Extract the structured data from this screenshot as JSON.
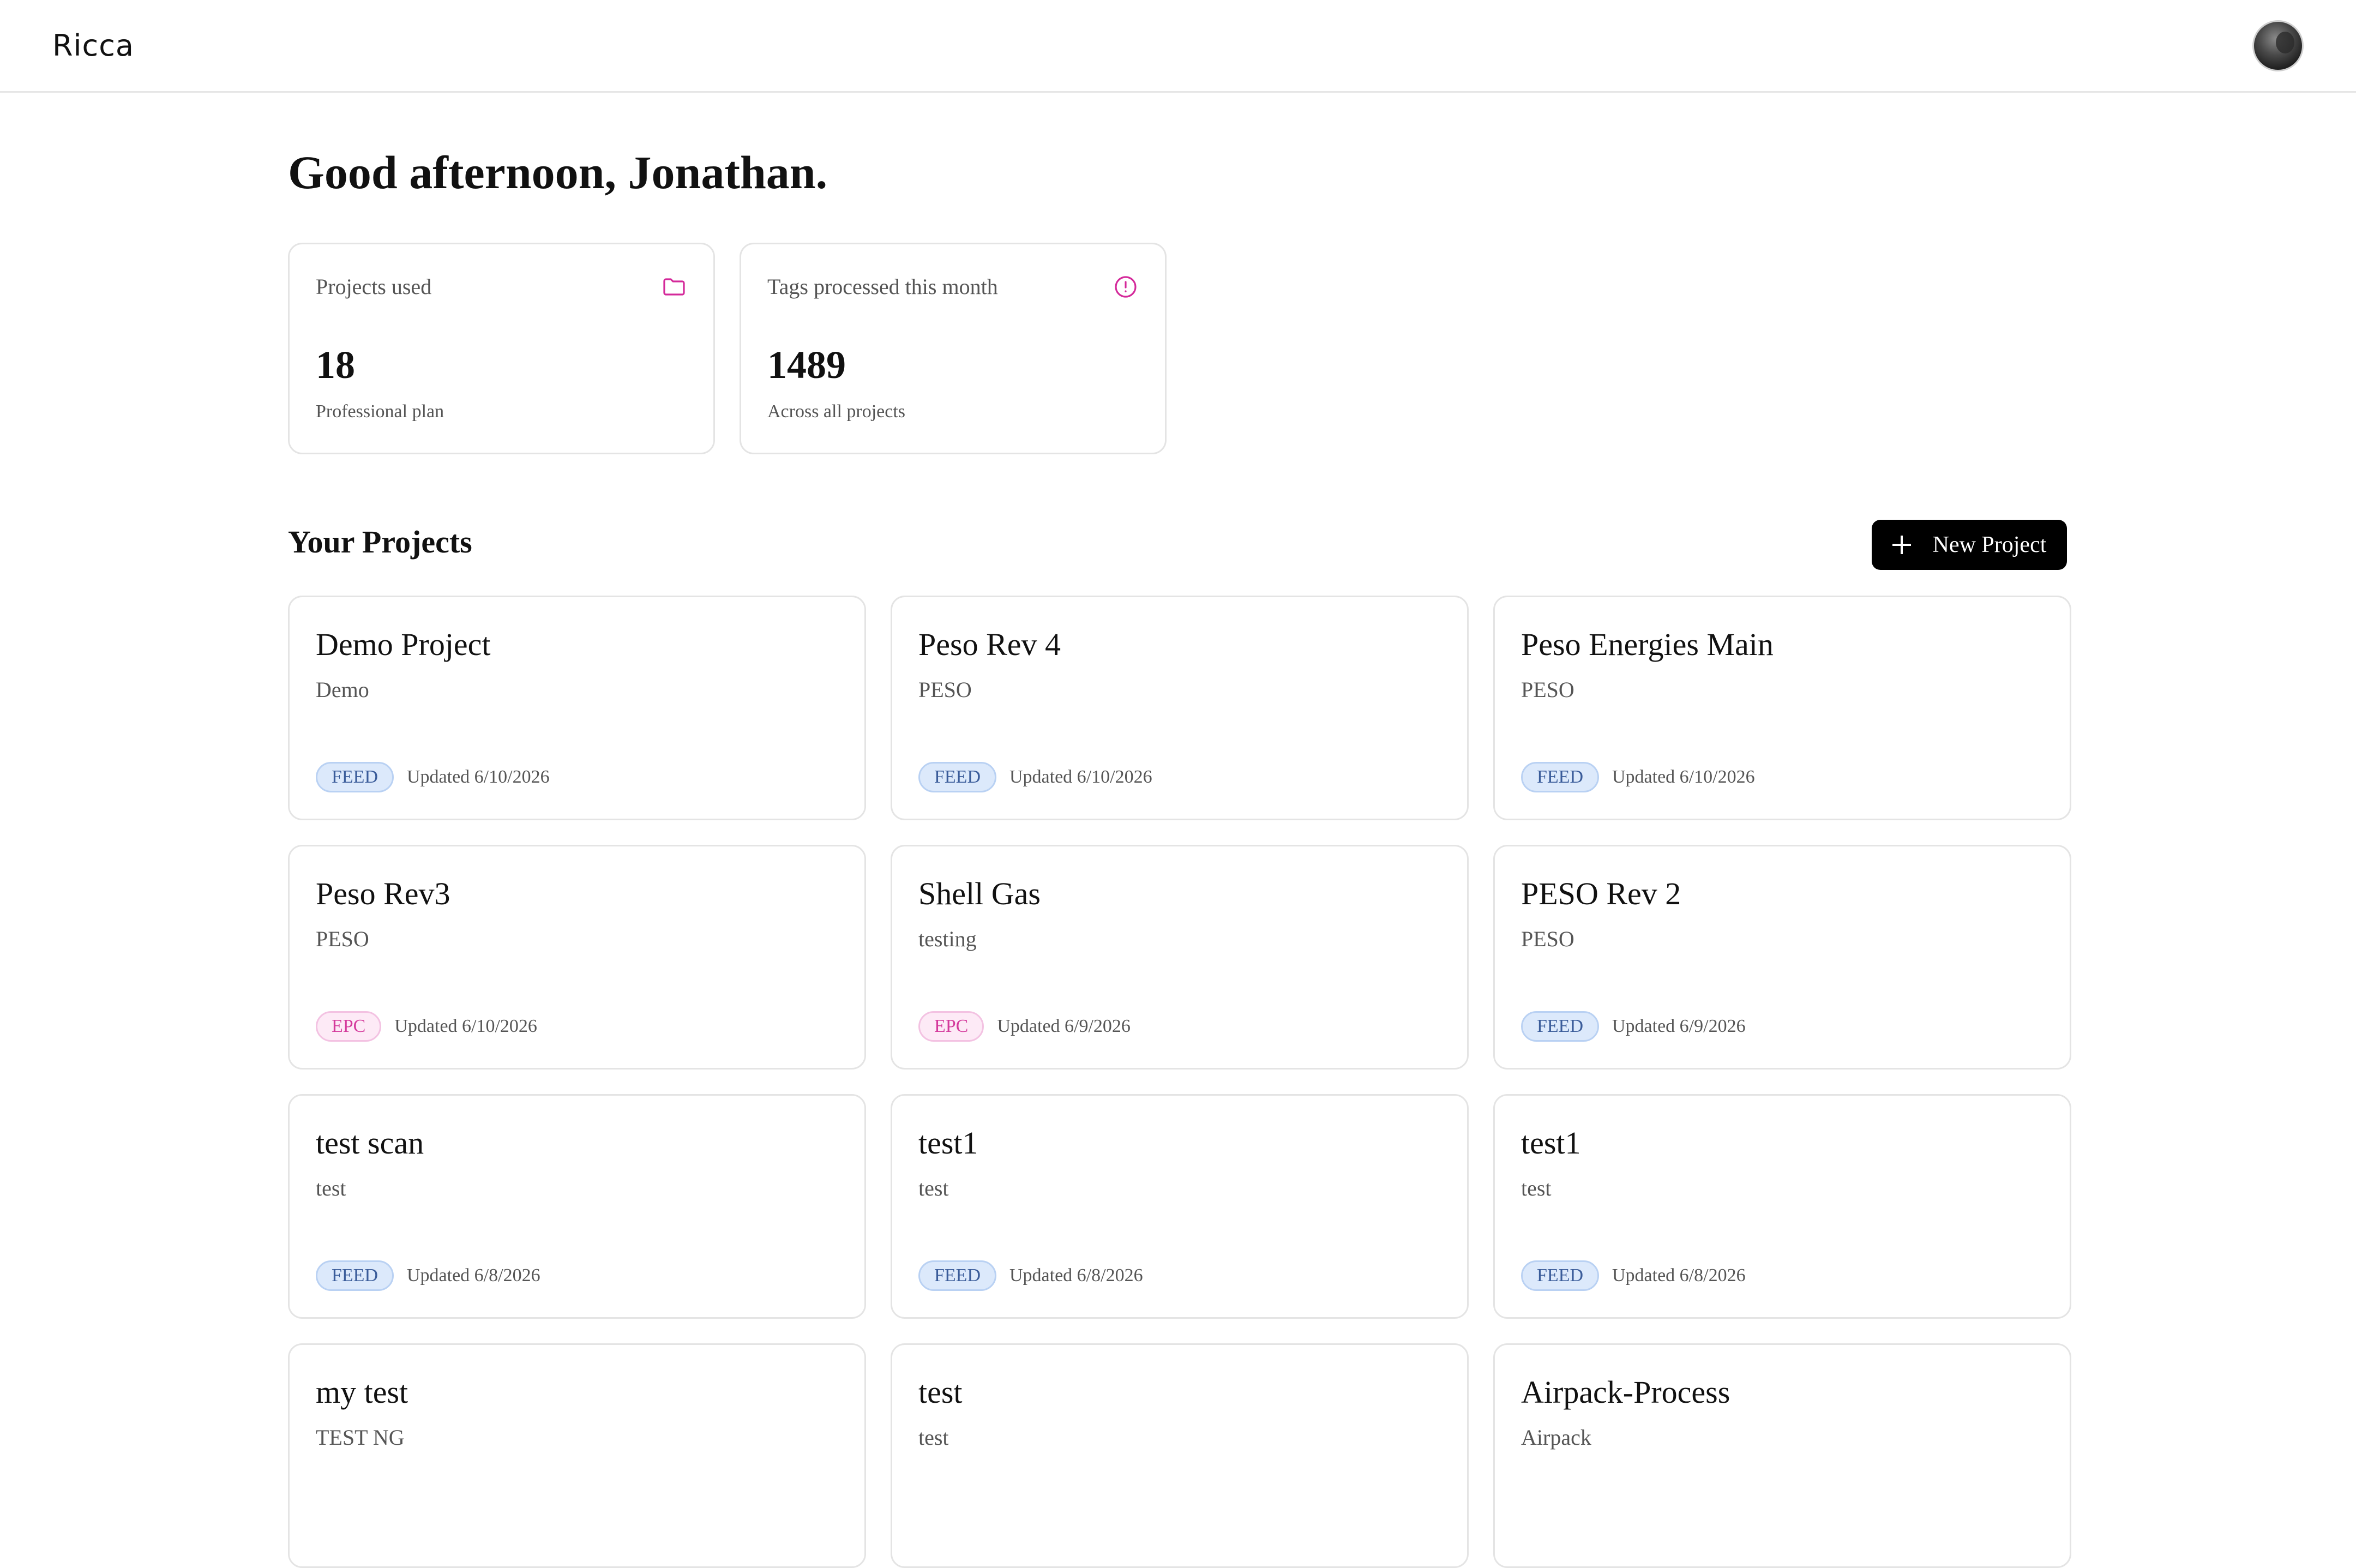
{
  "header": {
    "logo": "Ricca",
    "avatar_label": "user avatar"
  },
  "greeting": "Good afternoon, Jonathan.",
  "stats": [
    {
      "label": "Projects used",
      "value": "18",
      "sub": "Professional plan",
      "icon": "folder-icon"
    },
    {
      "label": "Tags processed this month",
      "value": "1489",
      "sub": "Across all projects",
      "icon": "alert-circle-icon"
    }
  ],
  "projects_section": {
    "title": "Your Projects",
    "new_button_label": "New Project"
  },
  "projects": [
    {
      "name": "Demo Project",
      "client": "Demo",
      "type": "FEED",
      "updated": "Updated 6/10/2026"
    },
    {
      "name": "Peso Rev 4",
      "client": "PESO",
      "type": "FEED",
      "updated": "Updated 6/10/2026"
    },
    {
      "name": "Peso Energies Main",
      "client": "PESO",
      "type": "FEED",
      "updated": "Updated 6/10/2026"
    },
    {
      "name": "Peso Rev3",
      "client": "PESO",
      "type": "EPC",
      "updated": "Updated 6/10/2026"
    },
    {
      "name": "Shell Gas",
      "client": "testing",
      "type": "EPC",
      "updated": "Updated 6/9/2026"
    },
    {
      "name": "PESO Rev 2",
      "client": "PESO",
      "type": "FEED",
      "updated": "Updated 6/9/2026"
    },
    {
      "name": "test scan",
      "client": "test",
      "type": "FEED",
      "updated": "Updated 6/8/2026"
    },
    {
      "name": "test1",
      "client": "test",
      "type": "FEED",
      "updated": "Updated 6/8/2026"
    },
    {
      "name": "test1",
      "client": "test",
      "type": "FEED",
      "updated": "Updated 6/8/2026"
    },
    {
      "name": "my test",
      "client": "TEST NG",
      "type": "",
      "updated": ""
    },
    {
      "name": "test",
      "client": "test",
      "type": "",
      "updated": ""
    },
    {
      "name": "Airpack-Process",
      "client": "Airpack",
      "type": "",
      "updated": ""
    }
  ],
  "colors": {
    "accent_pink": "#d4299a",
    "feed_badge_bg": "#dce9fb",
    "epc_badge_bg": "#fdeaf6"
  }
}
